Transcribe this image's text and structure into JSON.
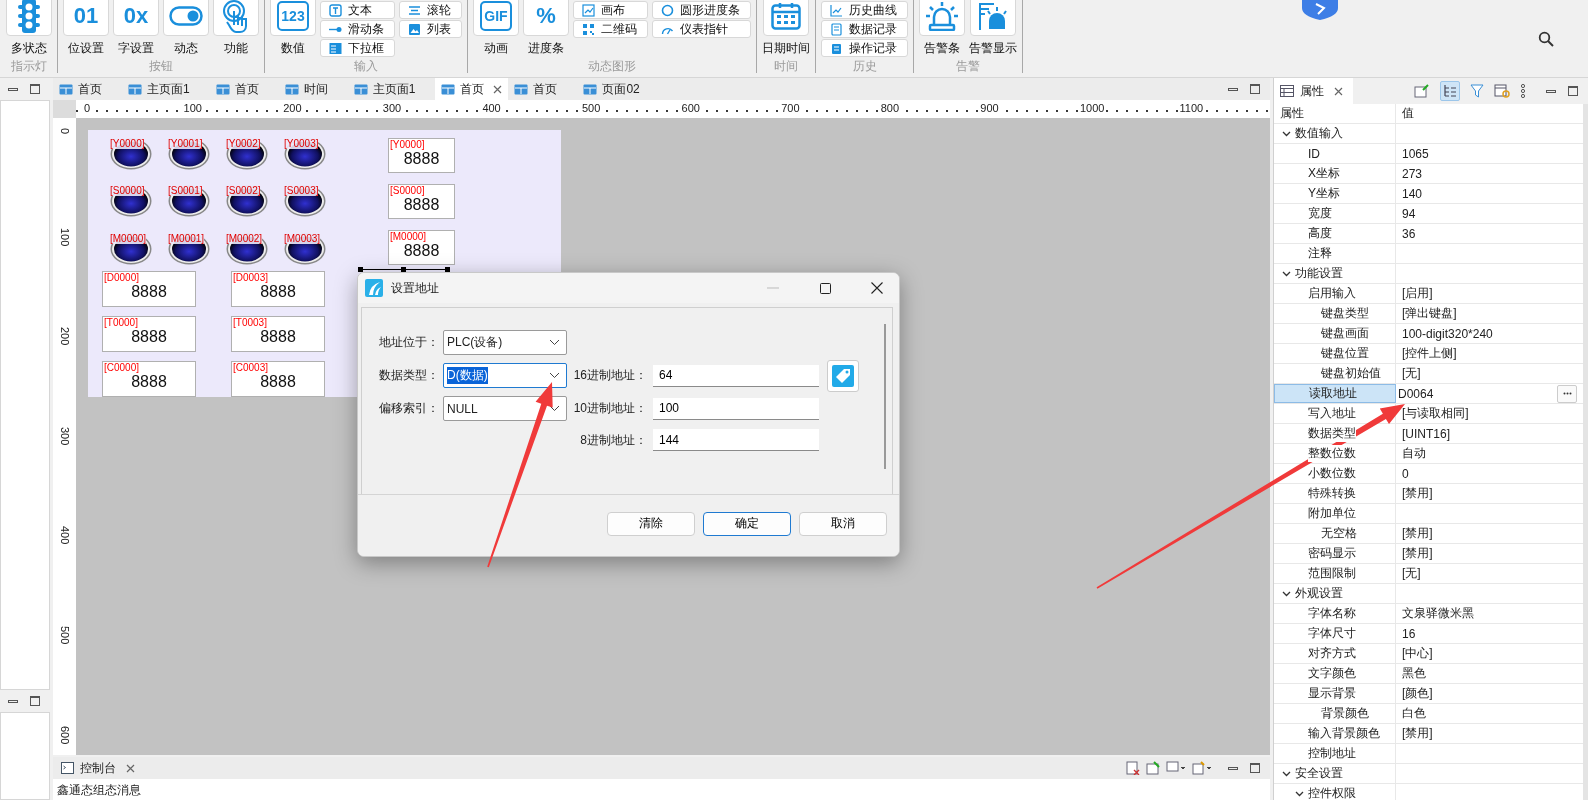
{
  "ribbon": {
    "groups": [
      {
        "label": "指示灯",
        "columns": [
          {
            "kind": "large",
            "label": "多状态"
          }
        ]
      },
      {
        "label": "按钮",
        "columns": [
          {
            "kind": "large",
            "label": "位设置",
            "glyph": "01"
          },
          {
            "kind": "large",
            "label": "字设置",
            "glyph": "0x"
          },
          {
            "kind": "large",
            "label": "动态"
          },
          {
            "kind": "large",
            "label": "功能"
          }
        ]
      },
      {
        "label": "输入",
        "columns": [
          {
            "kind": "large",
            "label": "数值",
            "glyph": "123"
          },
          {
            "kind": "stack",
            "items": [
              "文本",
              "滑动条",
              "下拉框"
            ]
          },
          {
            "kind": "stack",
            "items": [
              "滚轮",
              "列表"
            ]
          }
        ]
      },
      {
        "label": "动态图形",
        "columns": [
          {
            "kind": "large",
            "label": "动画",
            "glyph": "GIF"
          },
          {
            "kind": "large",
            "label": "进度条",
            "glyph": "%"
          },
          {
            "kind": "stack",
            "items": [
              "画布",
              "二维码"
            ]
          },
          {
            "kind": "stack",
            "items": [
              "圆形进度条",
              "仪表指针"
            ]
          }
        ]
      },
      {
        "label": "时间",
        "columns": [
          {
            "kind": "large",
            "label": "日期时间"
          }
        ]
      },
      {
        "label": "历史",
        "columns": [
          {
            "kind": "stack",
            "items": [
              "历史曲线",
              "数据记录",
              "操作记录"
            ]
          }
        ]
      },
      {
        "label": "告警",
        "columns": [
          {
            "kind": "large",
            "label": "告警条"
          },
          {
            "kind": "large",
            "label": "告警显示"
          }
        ]
      }
    ]
  },
  "editor": {
    "tabs": [
      {
        "label": "首页",
        "selected": false
      },
      {
        "label": "主页面1",
        "selected": false
      },
      {
        "label": "首页",
        "selected": false
      },
      {
        "label": "时间",
        "selected": false
      },
      {
        "label": "主页面1",
        "selected": false
      },
      {
        "label": "首页",
        "selected": true
      },
      {
        "label": "首页",
        "selected": false
      },
      {
        "label": "页面02",
        "selected": false
      }
    ],
    "ruler": {
      "horizontal": [
        "0",
        "100",
        "200",
        "300",
        "400",
        "500",
        "600",
        "700",
        "800",
        "900",
        "1000",
        "1100"
      ],
      "vertical": [
        "0",
        "100",
        "200",
        "300",
        "400",
        "500",
        "600"
      ]
    },
    "canvas": {
      "lamps": [
        {
          "address": "[Y0000]"
        },
        {
          "address": "[Y0001]"
        },
        {
          "address": "[Y0002]"
        },
        {
          "address": "[Y0003]"
        },
        {
          "address": "[S0000]"
        },
        {
          "address": "[S0001]"
        },
        {
          "address": "[S0002]"
        },
        {
          "address": "[S0003]"
        },
        {
          "address": "[M0000]"
        },
        {
          "address": "[M0001]"
        },
        {
          "address": "[M0002]"
        },
        {
          "address": "[M0003]"
        }
      ],
      "displays": [
        {
          "address": "[Y0000]",
          "value": "8888"
        },
        {
          "address": "[S0000]",
          "value": "8888"
        },
        {
          "address": "[M0000]",
          "value": "8888"
        }
      ],
      "inputs": [
        {
          "address": "[D0000]",
          "value": "8888"
        },
        {
          "address": "[D0003]",
          "value": "8888"
        },
        {
          "address": "[T0000]",
          "value": "8888"
        },
        {
          "address": "[T0003]",
          "value": "8888"
        },
        {
          "address": "[C0000]",
          "value": "8888"
        },
        {
          "address": "[C0003]",
          "value": "8888"
        }
      ]
    }
  },
  "dialog": {
    "title": "设置地址",
    "left_fields": [
      {
        "label": "地址位于：",
        "value": "PLC(设备)",
        "focused": false
      },
      {
        "label": "数据类型：",
        "value": "D(数据)",
        "focused": true
      },
      {
        "label": "偏移索引：",
        "value": "NULL",
        "focused": false
      }
    ],
    "right_fields": [
      {
        "label": "16进制地址：",
        "value": "64"
      },
      {
        "label": "10进制地址：",
        "value": "100"
      },
      {
        "label": "8进制地址：",
        "value": "144"
      }
    ],
    "buttons": [
      {
        "label": "清除",
        "default": false
      },
      {
        "label": "确定",
        "default": true
      },
      {
        "label": "取消",
        "default": false
      }
    ]
  },
  "console": {
    "title": "控制台",
    "message": "鑫通态组态消息"
  },
  "properties": {
    "title": "属性",
    "columns": [
      "属性",
      "值"
    ],
    "rows": [
      {
        "name": "数值输入",
        "expanded": true,
        "selected": false,
        "children": [
          {
            "name": "ID",
            "value": "1065",
            "selected": false
          },
          {
            "name": "X坐标",
            "value": "273",
            "selected": false
          },
          {
            "name": "Y坐标",
            "value": "140",
            "selected": false
          },
          {
            "name": "宽度",
            "value": "94",
            "selected": false
          },
          {
            "name": "高度",
            "value": "36",
            "selected": false
          },
          {
            "name": "注释",
            "selected": false
          }
        ]
      },
      {
        "name": "功能设置",
        "expanded": true,
        "selected": false,
        "children": [
          {
            "name": "启用输入",
            "value": "[启用]",
            "selected": false,
            "children": [
              {
                "name": "键盘类型",
                "value": "[弹出键盘]",
                "selected": false
              },
              {
                "name": "键盘画面",
                "value": "100-digit320*240",
                "selected": false
              },
              {
                "name": "键盘位置",
                "value": "[控件上侧]",
                "selected": false
              },
              {
                "name": "键盘初始值",
                "value": "[无]",
                "selected": false
              }
            ]
          },
          {
            "name": "读取地址",
            "value": "D0064",
            "selected": true
          },
          {
            "name": "写入地址",
            "value": "[与读取相同]",
            "selected": false
          },
          {
            "name": "数据类型",
            "value": "[UINT16]",
            "selected": false
          },
          {
            "name": "整数位数",
            "value": "自动",
            "selected": false
          },
          {
            "name": "小数位数",
            "value": "0",
            "selected": false
          },
          {
            "name": "特殊转换",
            "value": "[禁用]",
            "selected": false
          },
          {
            "name": "附加单位",
            "selected": false,
            "children": [
              {
                "name": "无空格",
                "value": "[禁用]",
                "selected": false
              }
            ]
          },
          {
            "name": "密码显示",
            "value": "[禁用]",
            "selected": false
          },
          {
            "name": "范围限制",
            "value": "[无]",
            "selected": false
          }
        ]
      },
      {
        "name": "外观设置",
        "expanded": true,
        "selected": false,
        "children": [
          {
            "name": "字体名称",
            "value": "文泉驿微米黑",
            "selected": false
          },
          {
            "name": "字体尺寸",
            "value": "16",
            "selected": false
          },
          {
            "name": "对齐方式",
            "value": "[中心]",
            "selected": false
          },
          {
            "name": "文字颜色",
            "value": "黑色",
            "selected": false
          },
          {
            "name": "显示背景",
            "value": "[颜色]",
            "selected": false,
            "children": [
              {
                "name": "背景颜色",
                "value": "白色",
                "selected": false
              }
            ]
          },
          {
            "name": "输入背景颜色",
            "value": "[禁用]",
            "selected": false
          },
          {
            "name": "控制地址",
            "selected": false
          }
        ]
      },
      {
        "name": "安全设置",
        "expanded": true,
        "selected": false,
        "children": [
          {
            "name": "控件权限",
            "expanded": true,
            "selected": false
          }
        ]
      }
    ]
  }
}
